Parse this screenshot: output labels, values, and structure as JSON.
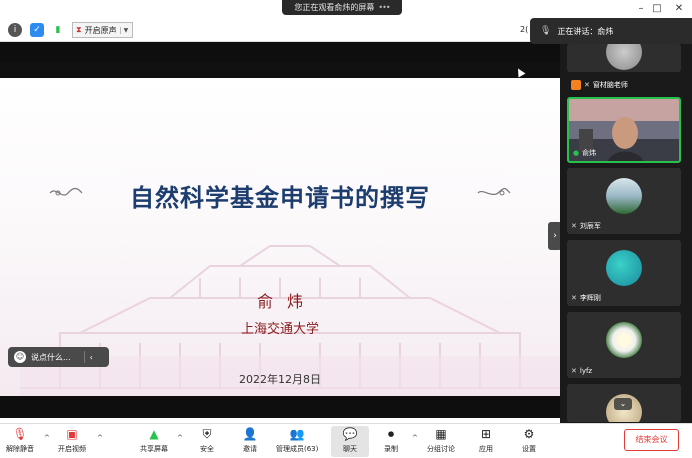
{
  "notice": {
    "text": "您正在观看俞炜的屏幕",
    "more": "•••"
  },
  "window": {
    "minimize": "–",
    "maximize": "□",
    "close": "✕"
  },
  "toolbar": {
    "original_sound_label": "开启原声",
    "right_fragment": "2("
  },
  "speaking": {
    "label": "正在讲话：俞炜"
  },
  "slide": {
    "title": "自然科学基金申请书的撰写",
    "author": "俞炜",
    "university": "上海交通大学",
    "date": "2022年12月8日"
  },
  "chat_pill": {
    "placeholder": "说点什么..."
  },
  "participants": [
    {
      "name": "",
      "avatar": "round-thumbnail"
    },
    {
      "name": "窗材脑老师",
      "avatar": "none"
    },
    {
      "name": "俞炜",
      "avatar": "video",
      "active": true
    },
    {
      "name": "刘辰军",
      "avatar": "landscape"
    },
    {
      "name": "李辉刚",
      "avatar": "teal-circle"
    },
    {
      "name": "lyfz",
      "avatar": "lotus"
    },
    {
      "name": "",
      "avatar": "partial"
    }
  ],
  "bottombar": {
    "unmute": "解除静音",
    "start_video": "开启视频",
    "share_screen": "共享屏幕",
    "security": "安全",
    "invite": "邀请",
    "manage_participants": "管理成员(63)",
    "chat": "聊天",
    "record": "录制",
    "breakout": "分组讨论",
    "apps": "应用",
    "settings": "设置",
    "end_meeting": "结束会议"
  },
  "colors": {
    "accent_green": "#27c24c",
    "end_red": "#e13a3a",
    "title_blue": "#1c3d6e",
    "subtitle_red": "#8a1c1c"
  }
}
